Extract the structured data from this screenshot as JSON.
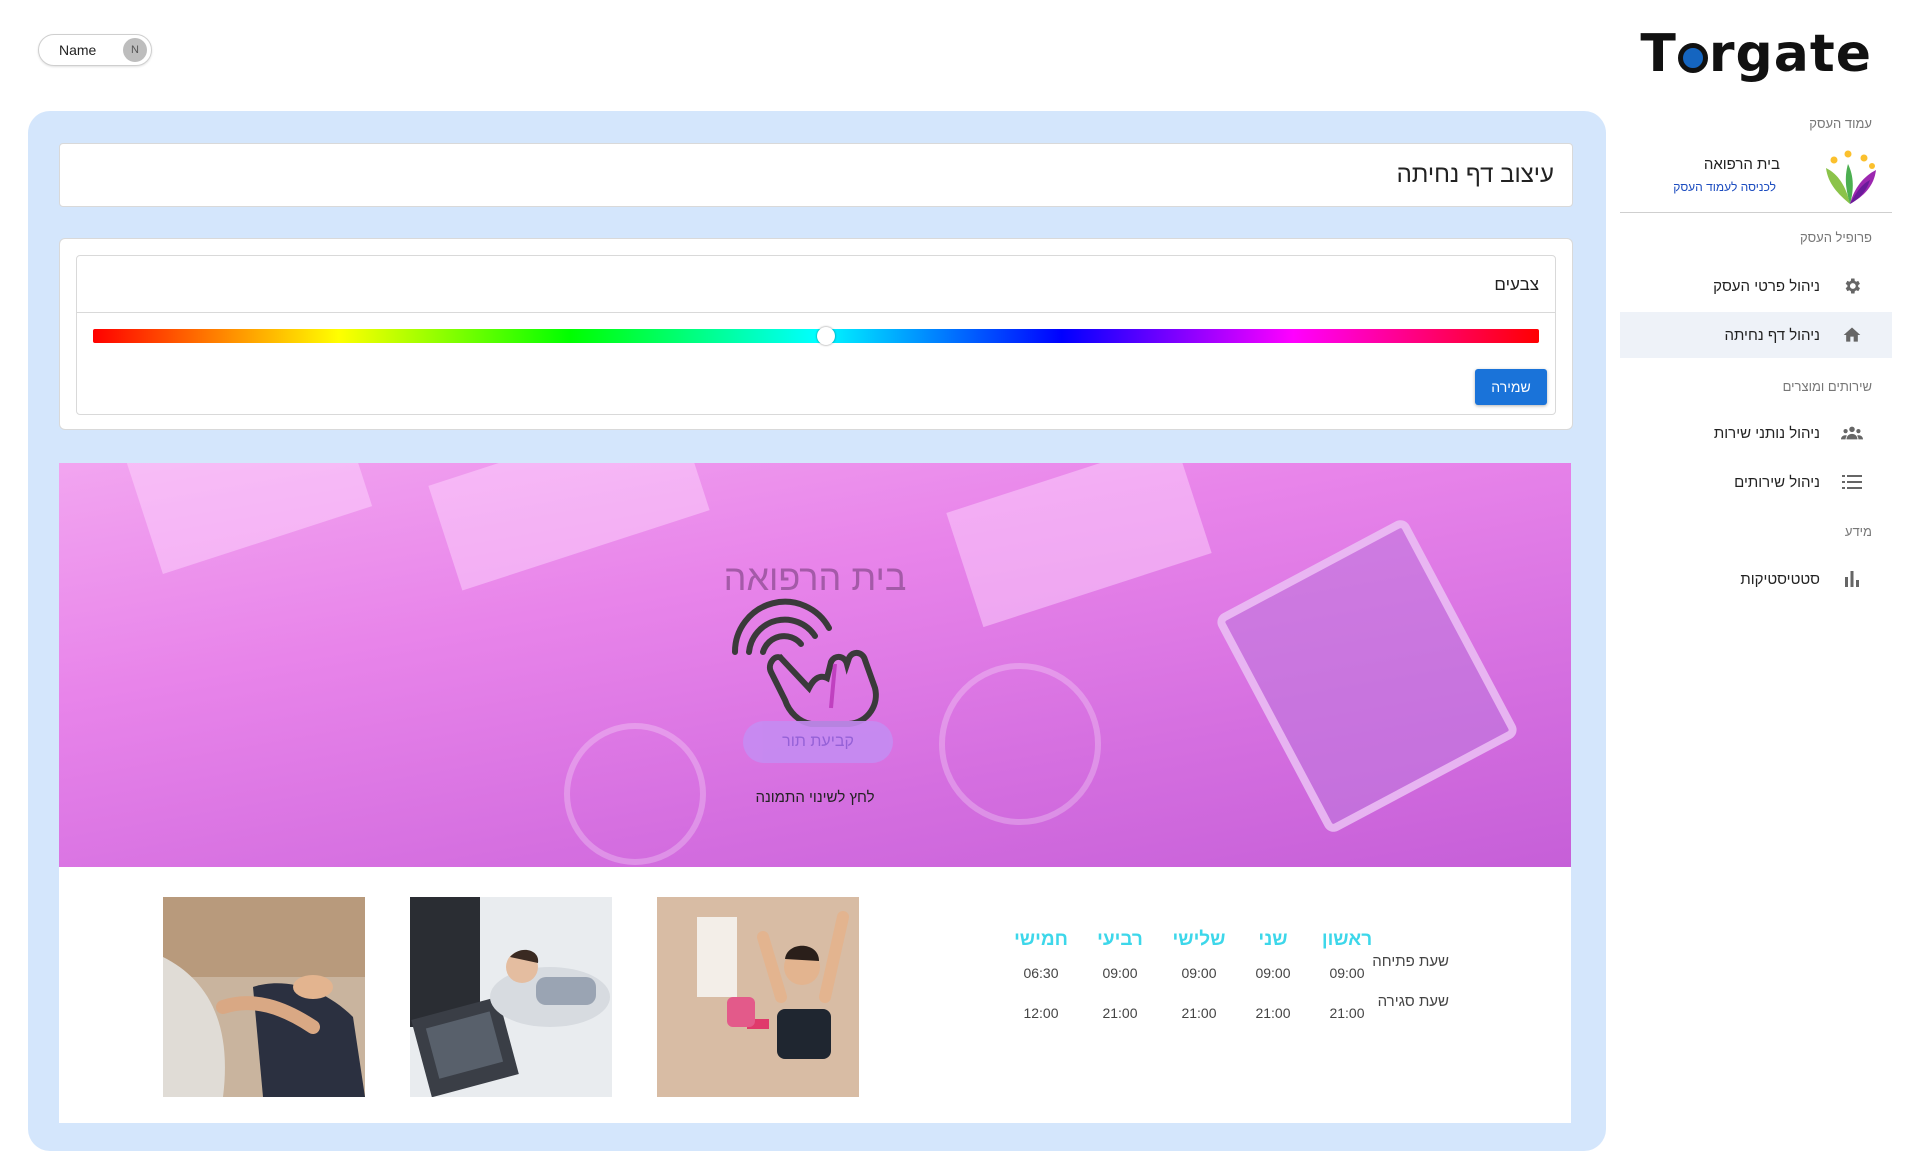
{
  "header": {
    "logo_text": "Torgate",
    "user": {
      "name": "Name",
      "initial": "N"
    }
  },
  "sidebar": {
    "section_business_page": "עמוד העסק",
    "business": {
      "name": "בית הרפואה",
      "link": "לכניסה לעמוד העסק"
    },
    "section_profile": "פרופיל העסק",
    "section_services": "שירותים ומוצרים",
    "section_info": "מידע",
    "items": [
      {
        "label": "ניהול פרטי העסק",
        "icon": "gear-icon"
      },
      {
        "label": "ניהול דף נחיתה",
        "icon": "home-icon",
        "active": true
      },
      {
        "label": "ניהול נותני שירות",
        "icon": "people-icon"
      },
      {
        "label": "ניהול שירותים",
        "icon": "list-icon"
      },
      {
        "label": "סטטיסטיקות",
        "icon": "bar-chart-icon"
      }
    ]
  },
  "main": {
    "title": "עיצוב דף נחיתה",
    "colors": {
      "heading": "צבעים",
      "hue_position": 0.507,
      "save_label": "שמירה"
    },
    "hero": {
      "title": "בית הרפואה",
      "button_label": "קביעת תור",
      "hint": "לחץ לשינוי התמונה",
      "overlay_color": "#e37ce8"
    },
    "hours": {
      "open_label": "שעת פתיחה",
      "close_label": "שעת סגירה",
      "days": [
        {
          "name": "ראשון",
          "open": "09:00",
          "close": "21:00"
        },
        {
          "name": "שני",
          "open": "09:00",
          "close": "21:00"
        },
        {
          "name": "שלישי",
          "open": "09:00",
          "close": "21:00"
        },
        {
          "name": "רביעי",
          "open": "09:00",
          "close": "21:00"
        },
        {
          "name": "חמישי",
          "open": "06:30",
          "close": "12:00"
        }
      ],
      "day_color": "#3dd7ea"
    }
  }
}
